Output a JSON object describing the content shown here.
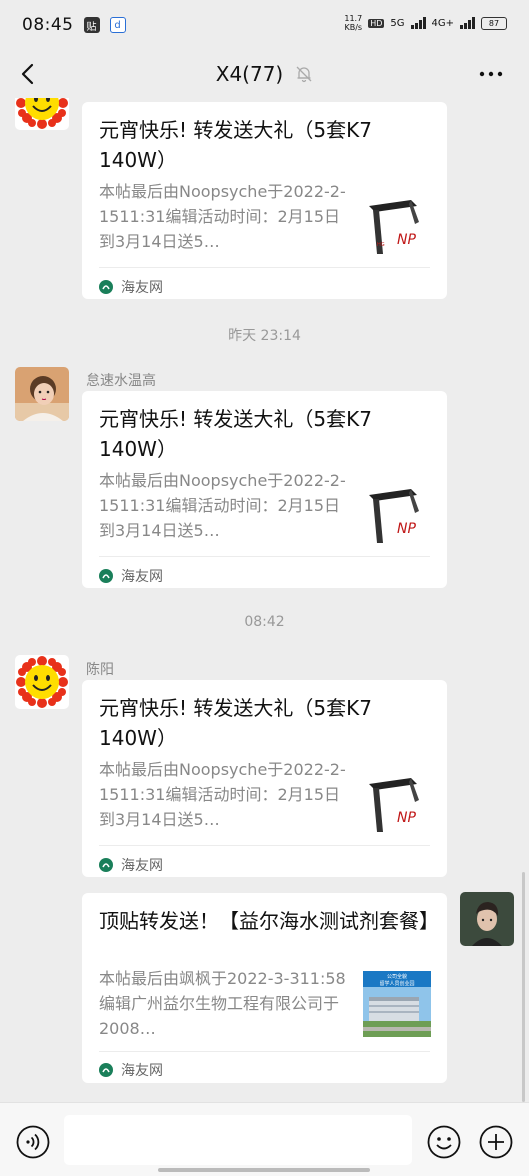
{
  "status_bar": {
    "time": "08:45",
    "app_icon_1": "贴",
    "app_icon_2": "d",
    "net_speed_value": "11.7",
    "net_speed_unit": "KB/s",
    "hd_label": "HD",
    "sim1_label": "5G",
    "sim2_label": "4G+",
    "battery": "87"
  },
  "nav": {
    "title": "X4(77)"
  },
  "messages": [
    {
      "sender": "",
      "avatar": "sun-avatar",
      "card": {
        "title": "元宵快乐! 转发送大礼（5套K7 140W）",
        "desc": "本帖最后由Noopsyche于2022-2-1511:31编辑活动时间：2月15日到3月14日送5…",
        "source": "海友网"
      }
    },
    {
      "timestamp": "昨天 23:14"
    },
    {
      "sender": "怠速水温高",
      "avatar": "child-photo-avatar",
      "card": {
        "title": "元宵快乐! 转发送大礼（5套K7 140W）",
        "desc": "本帖最后由Noopsyche于2022-2-1511:31编辑活动时间：2月15日到3月14日送5…",
        "source": "海友网"
      }
    },
    {
      "timestamp": "08:42"
    },
    {
      "sender": "陈阳",
      "avatar": "sun-avatar",
      "card": {
        "title": "元宵快乐! 转发送大礼（5套K7 140W）",
        "desc": "本帖最后由Noopsyche于2022-2-1511:31编辑活动时间：2月15日到3月14日送5…",
        "source": "海友网"
      }
    },
    {
      "sender": "",
      "avatar": "young-man-photo-avatar",
      "own": true,
      "card": {
        "title": "顶贴转发送！【益尔海水测试剂套餐】",
        "desc": "本帖最后由飒枫于2022-3-311:58编辑广州益尔生物工程有限公司于2008…",
        "source": "海友网",
        "thumb_text_1": "公司全貌",
        "thumb_text_2": "留学人员创业园"
      }
    }
  ],
  "input_bar": {
    "placeholder": "",
    "voice_icon": "voice-icon",
    "emoji_icon": "emoji-icon",
    "plus_icon": "plus-icon"
  },
  "colors": {
    "background": "#ededed",
    "card": "#ffffff",
    "source_icon": "#1a7f5a"
  }
}
